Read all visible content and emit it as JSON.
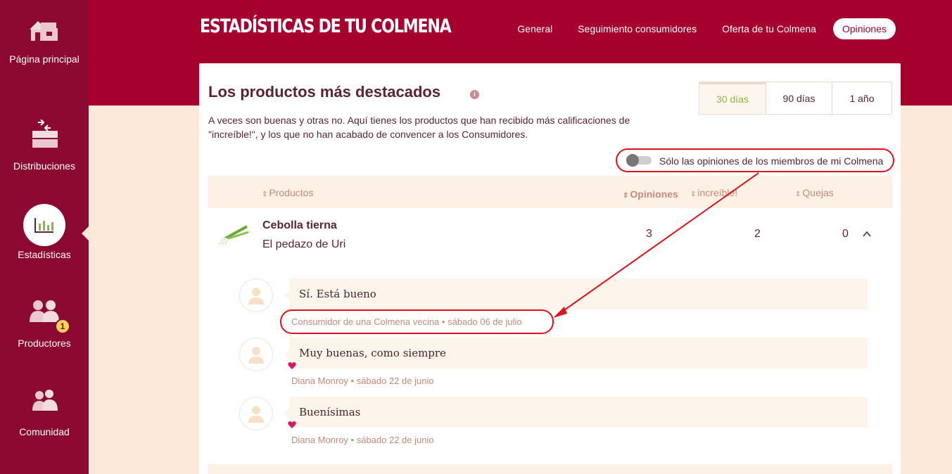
{
  "sidebar": {
    "items": [
      {
        "label": "Página principal",
        "icon": "house-icon"
      },
      {
        "label": "Distribuciones",
        "icon": "boxes-icon"
      },
      {
        "label": "Estadísticas",
        "icon": "chart-icon",
        "active": true
      },
      {
        "label": "Productores",
        "icon": "producers-icon",
        "badge": "1"
      },
      {
        "label": "Comunidad",
        "icon": "community-icon"
      }
    ]
  },
  "header": {
    "title": "ESTADÍSTICAS DE TU COLMENA",
    "nav": [
      "General",
      "Seguimiento consumidores",
      "Oferta de tu Colmena",
      "Opiniones"
    ],
    "active_nav": "Opiniones"
  },
  "card": {
    "title": "Los productos más destacados",
    "description": "A veces son buenas y otras no. Aquí tienes los productos que han recibido más calificaciones de \"increíble!\", y los que no han acabado de convencer a los Consumidores.",
    "ranges": [
      "30 días",
      "90 días",
      "1 año"
    ],
    "active_range": "30 días",
    "toggle_label": "Sólo las opiniones de los miembros de mi Colmena",
    "toggle_on": false
  },
  "table": {
    "headers": [
      "Productos",
      "Opiniones",
      "increíble!",
      "Quejas"
    ],
    "rows": [
      {
        "name": "Cebolla tierna",
        "producer": "El pedazo de Uri",
        "opiniones": "3",
        "increible": "2",
        "quejas": "0",
        "reviews": [
          {
            "text": "Sí. Está bueno",
            "author": "Consumidor de una Colmena vecina",
            "date": "sábado 06 de julio",
            "liked": false
          },
          {
            "text": "Muy buenas, como siempre",
            "author": "Diana Monroy",
            "date": "sábado 22 de junio",
            "liked": true
          },
          {
            "text": "Buenísimas",
            "author": "Diana Monroy",
            "date": "sábado 22 de junio",
            "liked": true
          }
        ]
      }
    ]
  },
  "colors": {
    "sidebar": "#8c0a31",
    "header": "#a6002f",
    "page_bg": "#fde9d9",
    "accent_green": "#8ab83a",
    "annotation_red": "#e0121b"
  }
}
